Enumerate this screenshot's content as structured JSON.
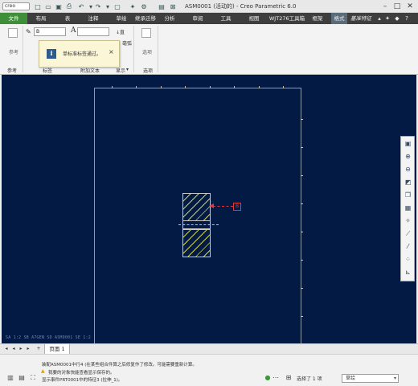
{
  "title": {
    "logo": "creo",
    "window_title": "ASM0001 (活动的) - Creo Parametric 6.0",
    "minimize": "–",
    "maximize": "□",
    "close": "✕"
  },
  "tabs": [
    {
      "label": "文件"
    },
    {
      "label": "布局"
    },
    {
      "label": "表"
    },
    {
      "label": "注释"
    },
    {
      "label": "草绘"
    },
    {
      "label": "继承迁移"
    },
    {
      "label": "分析"
    },
    {
      "label": "审阅"
    },
    {
      "label": "工具"
    },
    {
      "label": "视图"
    },
    {
      "label": "WJT276工具箱"
    },
    {
      "label": "框架"
    },
    {
      "label": "格式"
    },
    {
      "label": "基准特征"
    }
  ],
  "ribbon": {
    "reference_label": "参考",
    "reference_group": "参考",
    "label_group": "标签",
    "additional_text_group": "附加文本",
    "display_group": "显示",
    "display_arrow": "▾",
    "options_group": "选项",
    "options_label": "选项",
    "text_label_value": "B",
    "additional_font": "A",
    "text_arrow": "↓直",
    "angle_label": "毫弧"
  },
  "tooltip": {
    "message": "单标准标签通过。",
    "close": "×"
  },
  "canvas": {
    "note_letter": "B",
    "status_text": "SA  1:2    SB  A7GEN  SD  ASM0001  SE  1:2"
  },
  "sheets": {
    "tab_label": "页面 1",
    "add": "+"
  },
  "messages": [
    "装配ASM0001中行4 (在某些组合件算之后修复作了修改。可能需要重新计算。",
    "我要的对象快能查看显示保存的。",
    "显示事件PRT0001中的特征3 (拉伸_1)。"
  ],
  "status": {
    "selected_count": "选择了 1 项",
    "filter": "草绘"
  },
  "colors": {
    "canvas_bg": "#021a44",
    "file_tab": "#3f8f3a",
    "tab_bar": "#3e3e3e",
    "hatch": "#cfd250",
    "note_red": "#e03a3a"
  }
}
